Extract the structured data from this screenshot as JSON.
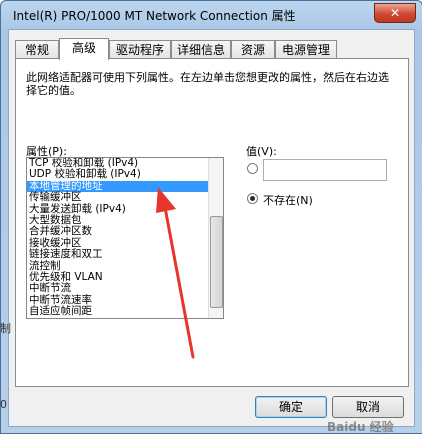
{
  "window": {
    "title": "Intel(R) PRO/1000 MT Network Connection 属性",
    "close_glyph": "✕"
  },
  "tabs": [
    {
      "label": "常规"
    },
    {
      "label": "高级"
    },
    {
      "label": "驱动程序"
    },
    {
      "label": "详细信息"
    },
    {
      "label": "资源"
    },
    {
      "label": "电源管理"
    }
  ],
  "active_tab": "高级",
  "panel": {
    "description": "此网络适配器可使用下列属性。在左边单击您想更改的属性，然后在右边选择它的值。",
    "property_label": "属性(P):",
    "value_label": "值(V):",
    "not_present_label": "不存在(N)",
    "value_input": ""
  },
  "properties": [
    "TCP 校验和卸载 (IPv4)",
    "UDP 校验和卸载 (IPv4)",
    "本地管理的地址",
    "传输缓冲区",
    "大量发送卸载 (IPv4)",
    "大型数据包",
    "合并缓冲区数",
    "接收缓冲区",
    "链接速度和双工",
    "流控制",
    "优先级和 VLAN",
    "中断节流",
    "中断节流速率",
    "自适应帧间距"
  ],
  "selected_property": "本地管理的地址",
  "buttons": {
    "ok": "确定",
    "cancel": "取消"
  },
  "background_fragments": [
    "制",
    "0"
  ],
  "colors": {
    "selection": "#3399ff",
    "annotation_arrow": "#e8352c"
  },
  "watermark": "Baidu 经验"
}
